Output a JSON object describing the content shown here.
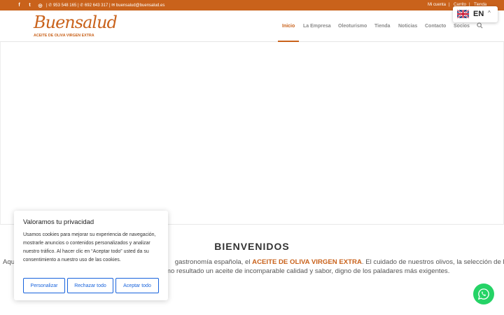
{
  "topbar": {
    "social": [
      {
        "icon": "facebook-icon",
        "glyph": "f"
      },
      {
        "icon": "twitter-icon",
        "glyph": "t"
      },
      {
        "icon": "instagram-icon",
        "glyph": "◎"
      }
    ],
    "phone1": "953 548 165",
    "phone2": "692 643 317",
    "email": "buensalud@buensalud.es",
    "links": [
      "Mi cuenta",
      "Carrito",
      "Tienda"
    ]
  },
  "logo": {
    "word": "Buensalud",
    "subtitle": "ACEITE DE OLIVA VIRGEN EXTRA"
  },
  "nav": {
    "items": [
      "Inicio",
      "La Empresa",
      "Oleoturismo",
      "Tienda",
      "Noticias",
      "Contacto",
      "Socios"
    ],
    "active": "Inicio"
  },
  "language": {
    "code": "EN",
    "flag": "uk-flag-icon"
  },
  "welcome": {
    "title": "BIENVENIDOS",
    "line1_pre": "Aqu",
    "line1_mid": " gastronomía española, el ",
    "line1_highlight": "ACEITE DE OLIVA VIRGEN EXTRA",
    "line1_post": ". El cuidado de nuestros olivos, la selección de la mejor",
    "line2": "mo resultado un aceite de incomparable calidad y sabor, digno de los paladares más exigentes."
  },
  "cookie": {
    "title": "Valoramos tu privacidad",
    "text": "Usamos cookies para mejorar su experiencia de navegación, mostrarle anuncios o contenidos personalizados y analizar nuestro tráfico. Al hacer clic en “Aceptar todo” usted da su consentimiento a nuestro uso de las cookies.",
    "customize": "Personalizar",
    "reject": "Rechazar todo",
    "accept": "Aceptar todo"
  },
  "colors": {
    "brand": "#c9621b",
    "cookie_button": "#1863dc",
    "whatsapp": "#25d366"
  }
}
